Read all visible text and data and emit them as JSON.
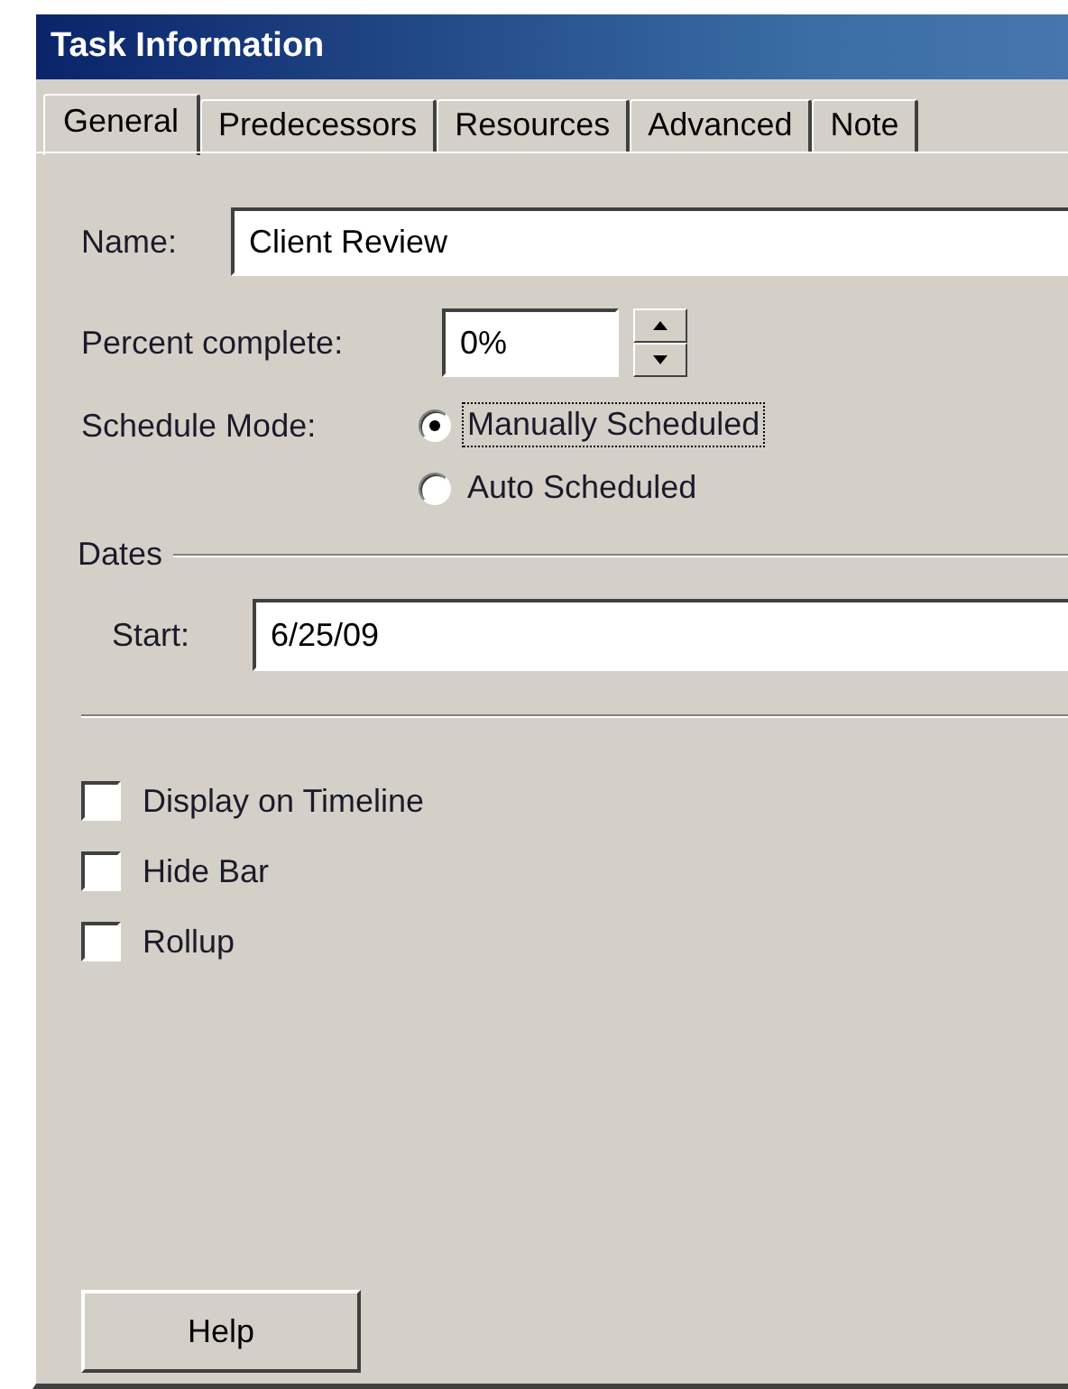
{
  "window": {
    "title": "Task Information"
  },
  "tabs": [
    {
      "label": "General",
      "selected": true
    },
    {
      "label": "Predecessors",
      "selected": false
    },
    {
      "label": "Resources",
      "selected": false
    },
    {
      "label": "Advanced",
      "selected": false
    },
    {
      "label": "Note",
      "selected": false
    }
  ],
  "name_field": {
    "label": "Name:",
    "value": "Client Review"
  },
  "percent_field": {
    "label": "Percent complete:",
    "value": "0%"
  },
  "schedule_mode": {
    "label": "Schedule Mode:",
    "options": [
      {
        "label": "Manually Scheduled",
        "selected": true,
        "focused": true
      },
      {
        "label": "Auto Scheduled",
        "selected": false,
        "focused": false
      }
    ]
  },
  "dates": {
    "title": "Dates",
    "start": {
      "label": "Start:",
      "value": "6/25/09"
    }
  },
  "checkboxes": [
    {
      "label": "Display on Timeline",
      "checked": false
    },
    {
      "label": "Hide Bar",
      "checked": false
    },
    {
      "label": "Rollup",
      "checked": false
    }
  ],
  "buttons": [
    {
      "label": "Help"
    }
  ]
}
